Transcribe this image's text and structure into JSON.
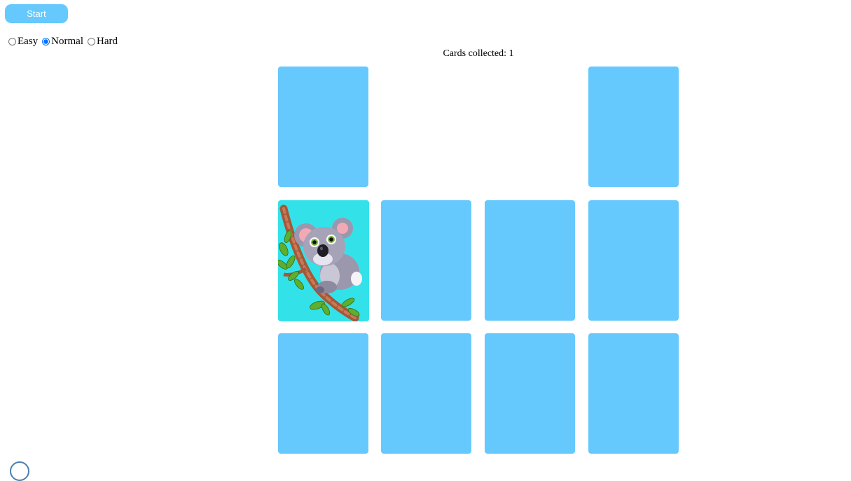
{
  "controls": {
    "start_label": "Start",
    "difficulty": [
      {
        "label": "Easy",
        "checked": false
      },
      {
        "label": "Normal",
        "checked": true
      },
      {
        "label": "Hard",
        "checked": false
      }
    ]
  },
  "status": {
    "cards_collected_text": "Cards collected: 1"
  },
  "board": {
    "rows": 3,
    "cols": 4,
    "cards": [
      {
        "state": "face-down"
      },
      {
        "state": "collected"
      },
      {
        "state": "collected"
      },
      {
        "state": "face-down"
      },
      {
        "state": "revealed",
        "picture": "koala"
      },
      {
        "state": "face-down"
      },
      {
        "state": "face-down"
      },
      {
        "state": "face-down"
      },
      {
        "state": "face-down"
      },
      {
        "state": "face-down"
      },
      {
        "state": "face-down"
      },
      {
        "state": "face-down"
      }
    ]
  },
  "colors": {
    "card_back": "#66c9fd",
    "revealed_bg": "#33e2e8",
    "button_bg": "#66c9fd"
  }
}
